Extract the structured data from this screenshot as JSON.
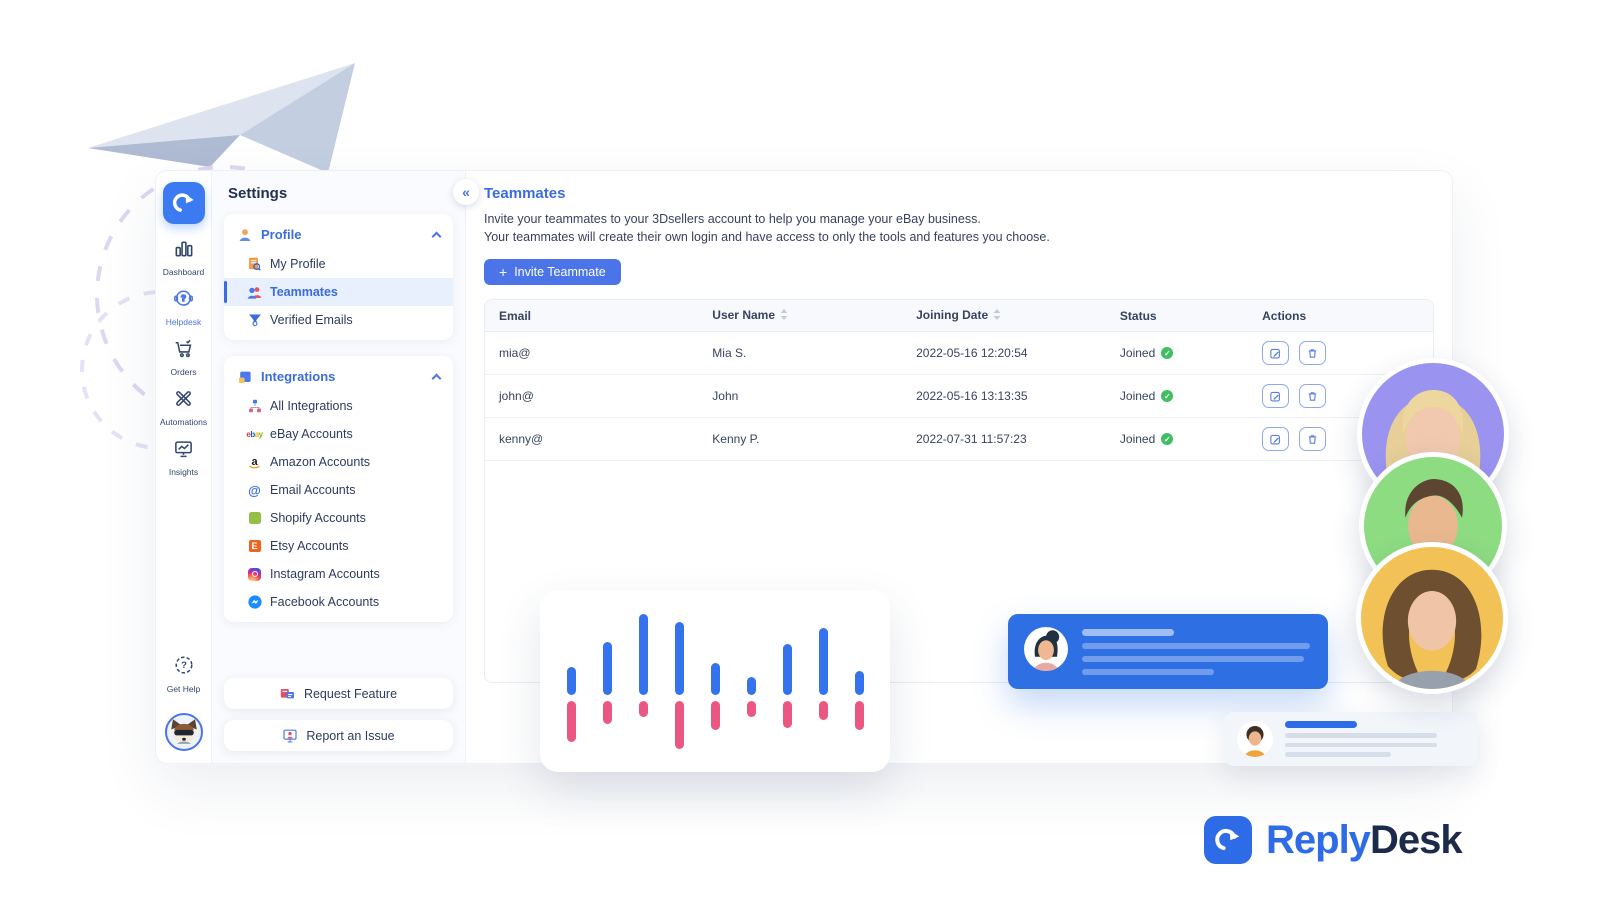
{
  "colors": {
    "accent": "#4a74e8",
    "brand_blue": "#2e6be6",
    "brand_dark": "#1d2b4a",
    "success": "#3fbf62",
    "selected_item_bg": "#e9f0fd",
    "chart_up": "#3472ee",
    "chart_down": "#ea5782",
    "avatar_rings": [
      "#9b93f0",
      "#8ddc82",
      "#f3c257"
    ]
  },
  "icon_sidebar": {
    "logo_icon": "reply-arrow-icon",
    "items": [
      {
        "label": "Dashboard",
        "icon": "bar-chart-icon",
        "active": false
      },
      {
        "label": "Helpdesk",
        "icon": "headset-icon",
        "active": true
      },
      {
        "label": "Orders",
        "icon": "cart-icon",
        "active": false
      },
      {
        "label": "Automations",
        "icon": "tools-icon",
        "active": false
      },
      {
        "label": "Insights",
        "icon": "monitor-icon",
        "active": false
      }
    ],
    "get_help_label": "Get Help",
    "user_avatar": "dog-avatar"
  },
  "settings_panel": {
    "title": "Settings",
    "profile_group": {
      "label": "Profile",
      "icon": "person-icon",
      "items": [
        {
          "label": "My Profile",
          "icon": "profile-doc-icon",
          "selected": false
        },
        {
          "label": "Teammates",
          "icon": "teammates-icon",
          "selected": true
        },
        {
          "label": "Verified Emails",
          "icon": "funnel-icon",
          "selected": false
        }
      ]
    },
    "integrations_group": {
      "label": "Integrations",
      "icon": "puzzle-icon",
      "items": [
        {
          "label": "All Integrations",
          "icon": "hierarchy-icon"
        },
        {
          "label": "eBay Accounts",
          "icon": "ebay-icon"
        },
        {
          "label": "Amazon Accounts",
          "icon": "amazon-icon"
        },
        {
          "label": "Email Accounts",
          "icon": "at-sign-icon"
        },
        {
          "label": "Shopify Accounts",
          "icon": "shopify-icon"
        },
        {
          "label": "Etsy Accounts",
          "icon": "etsy-icon"
        },
        {
          "label": "Instagram Accounts",
          "icon": "instagram-icon"
        },
        {
          "label": "Facebook Accounts",
          "icon": "messenger-icon"
        }
      ]
    },
    "footer_buttons": [
      {
        "label": "Request Feature",
        "icon": "feature-icon"
      },
      {
        "label": "Report an Issue",
        "icon": "issue-icon"
      }
    ]
  },
  "main": {
    "collapse_icon": "double-chevron-left-icon",
    "title": "Teammates",
    "description": [
      "Invite your teammates to your 3Dsellers account to help you manage your eBay business.",
      "Your teammates will create their own login and have access to only the tools and features you choose."
    ],
    "invite_button": {
      "icon": "plus-icon",
      "label": "Invite Teammate"
    },
    "table": {
      "columns": [
        "Email",
        "User Name",
        "Joining Date",
        "Status",
        "Actions"
      ],
      "sortable_columns": [
        "User Name",
        "Joining Date"
      ],
      "action_icons": [
        "edit-icon",
        "trash-icon"
      ],
      "rows": [
        {
          "email": "mia@",
          "user_name": "Mia S.",
          "joining_date": "2022-05-16 12:20:54",
          "status": "Joined"
        },
        {
          "email": "john@",
          "user_name": "John",
          "joining_date": "2022-05-16 13:13:35",
          "status": "Joined"
        },
        {
          "email": "kenny@",
          "user_name": "Kenny P.",
          "joining_date": "2022-07-31 11:57:23",
          "status": "Joined"
        }
      ]
    }
  },
  "brand": {
    "logo_text_primary": "Reply",
    "logo_text_secondary": "Desk"
  },
  "chart_data": {
    "type": "bar",
    "title": "",
    "note": "decorative mini bar chart, no axes; values are relative heights in px above/below a center baseline",
    "categories": [
      "1",
      "2",
      "3",
      "4",
      "5",
      "6",
      "7",
      "8",
      "9"
    ],
    "series": [
      {
        "name": "up",
        "color": "#3472ee",
        "values": [
          28,
          53,
          81,
          73,
          32,
          18,
          51,
          67,
          24
        ]
      },
      {
        "name": "down",
        "color": "#ea5782",
        "values": [
          41,
          23,
          16,
          48,
          29,
          16,
          27,
          19,
          29
        ]
      }
    ]
  }
}
